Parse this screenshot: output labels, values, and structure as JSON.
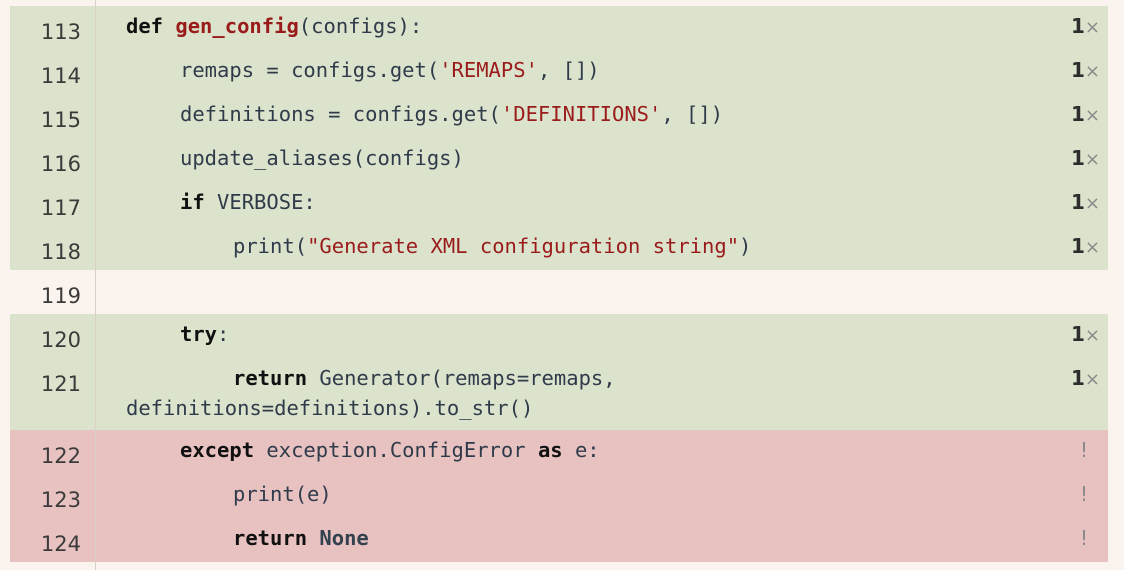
{
  "colors": {
    "page_background": "#fbf3ee",
    "covered_line": "#dce3cc",
    "missed_line": "#e8c2c0",
    "keyword": "#111111",
    "function_name": "#9a1b1b",
    "string": "#9a1b1b"
  },
  "lines": [
    {
      "number": "113",
      "status": "covered",
      "hits": "1",
      "times": "×",
      "code": {
        "kw1": "def",
        "fn": "gen_config",
        "rest": "(configs):"
      }
    },
    {
      "number": "114",
      "status": "covered",
      "hits": "1",
      "times": "×",
      "code": {
        "pre": "remaps = configs.get(",
        "str": "'REMAPS'",
        "post": ", [])"
      }
    },
    {
      "number": "115",
      "status": "covered",
      "hits": "1",
      "times": "×",
      "code": {
        "pre": "definitions = configs.get(",
        "str": "'DEFINITIONS'",
        "post": ", [])"
      }
    },
    {
      "number": "116",
      "status": "covered",
      "hits": "1",
      "times": "×",
      "code": {
        "text": "update_aliases(configs)"
      }
    },
    {
      "number": "117",
      "status": "covered",
      "hits": "1",
      "times": "×",
      "code": {
        "kw": "if",
        "rest": " VERBOSE:"
      }
    },
    {
      "number": "118",
      "status": "covered",
      "hits": "1",
      "times": "×",
      "code": {
        "pre": "print(",
        "str": "\"Generate XML configuration string\"",
        "post": ")"
      }
    },
    {
      "number": "119",
      "status": "blank"
    },
    {
      "number": "120",
      "status": "covered",
      "hits": "1",
      "times": "×",
      "code": {
        "kw": "try",
        "rest": ":"
      }
    },
    {
      "number": "121",
      "status": "covered",
      "hits": "1",
      "times": "×",
      "code": {
        "kw": "return",
        "rest": " Generator(remaps=remaps,",
        "wrap": "definitions=definitions).to_str()"
      }
    },
    {
      "number": "122",
      "status": "missed",
      "mark": "!",
      "code": {
        "kw": "except",
        "mid": " exception.ConfigError ",
        "kw2": "as",
        "rest": " e:"
      }
    },
    {
      "number": "123",
      "status": "missed",
      "mark": "!",
      "code": {
        "text": "print(e)"
      }
    },
    {
      "number": "124",
      "status": "missed",
      "mark": "!",
      "code": {
        "kw": "return",
        "space": " ",
        "const": "None"
      }
    }
  ]
}
